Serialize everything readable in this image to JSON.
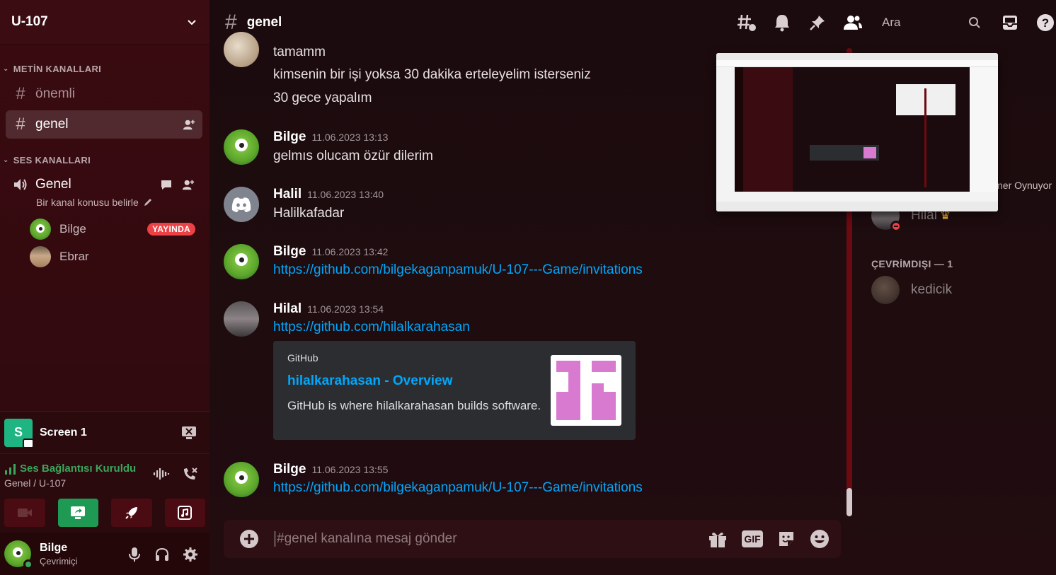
{
  "server": {
    "name": "U-107"
  },
  "sidebar": {
    "text_category": "METİN KANALLARI",
    "voice_category": "SES KANALLARI",
    "text_channels": [
      {
        "name": "önemli"
      },
      {
        "name": "genel"
      }
    ],
    "voice_channel": {
      "name": "Genel",
      "topic": "Bir kanal konusu belirle",
      "members": [
        {
          "name": "Bilge",
          "badge": "YAYINDA"
        },
        {
          "name": "Ebrar"
        }
      ]
    },
    "screen_share": {
      "label": "Screen 1",
      "icon_letter": "S"
    },
    "voice_status": {
      "title": "Ses Bağlantısı Kuruldu",
      "subtitle": "Genel / U-107"
    },
    "user": {
      "name": "Bilge",
      "status": "Çevrimiçi"
    }
  },
  "topbar": {
    "channel": "genel",
    "search_placeholder": "Ara"
  },
  "messages": [
    {
      "author": "",
      "time": "",
      "lines": [
        "tamamm",
        "kimsenin bir işi yoksa 30 dakika erteleyelim isterseniz",
        "30 gece yapalım"
      ]
    },
    {
      "author": "Bilge",
      "time": "11.06.2023 13:13",
      "text": "gelmıs olucam özür dilerim"
    },
    {
      "author": "Halil",
      "time": "11.06.2023 13:40",
      "text": "Halilkafadar"
    },
    {
      "author": "Bilge",
      "time": "11.06.2023 13:42",
      "link": "https://github.com/bilgekaganpamuk/U-107---Game/invitations"
    },
    {
      "author": "Hilal",
      "time": "11.06.2023 13:54",
      "link": "https://github.com/hilalkarahasan"
    },
    {
      "author": "Bilge",
      "time": "11.06.2023 13:55",
      "link": "https://github.com/bilgekaganpamuk/U-107---Game/invitations"
    }
  ],
  "embed": {
    "provider": "GitHub",
    "title": "hilalkarahasan - Overview",
    "description": "GitHub is where hilalkarahasan builds software."
  },
  "composer": {
    "placeholder": "#genel kanalına mesaj gönder",
    "gif_label": "GIF"
  },
  "members": {
    "game_fragment": "ner Oynuyor",
    "online_member": "Hilal",
    "offline_header": "ÇEVRİMDIŞI — 1",
    "offline_member": "kedicik"
  },
  "colors": {
    "accent_link": "#00a8fc",
    "live_red": "#ed4245",
    "online_green": "#3ba55c",
    "sidebar_bg": "#3a0b10"
  }
}
